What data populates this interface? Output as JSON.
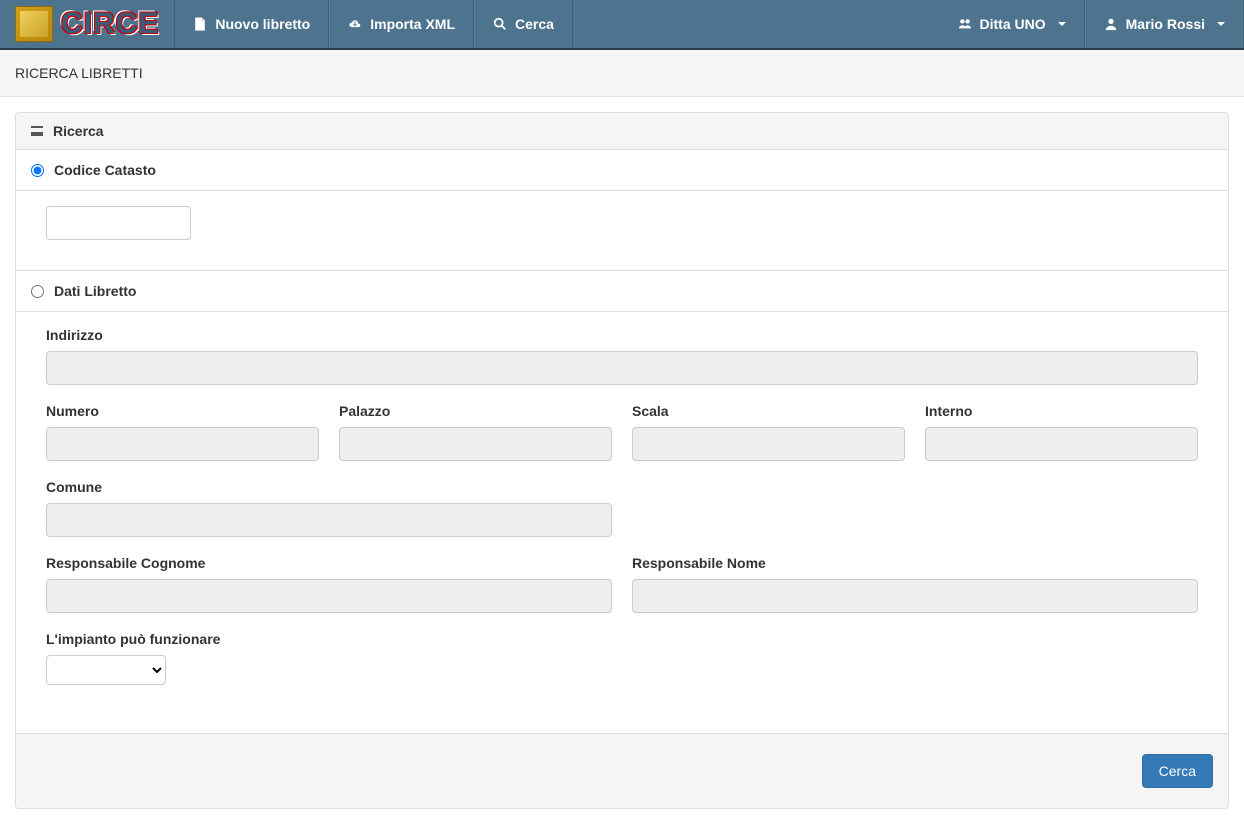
{
  "navbar": {
    "brand": "CIRCE",
    "nuovo_libretto": "Nuovo libretto",
    "importa_xml": "Importa XML",
    "cerca": "Cerca",
    "ditta": "Ditta UNO",
    "user": "Mario Rossi"
  },
  "page_title": "RICERCA LIBRETTI",
  "panel_title": "Ricerca",
  "sections": {
    "codice_catasto": {
      "label": "Codice Catasto"
    },
    "dati_libretto": {
      "label": "Dati Libretto"
    }
  },
  "fields": {
    "indirizzo": "Indirizzo",
    "numero": "Numero",
    "palazzo": "Palazzo",
    "scala": "Scala",
    "interno": "Interno",
    "comune": "Comune",
    "resp_cognome": "Responsabile Cognome",
    "resp_nome": "Responsabile Nome",
    "impianto_funz": "L'impianto può funzionare"
  },
  "values": {
    "codice_catasto": "",
    "indirizzo": "",
    "numero": "",
    "palazzo": "",
    "scala": "",
    "interno": "",
    "comune": "",
    "resp_cognome": "",
    "resp_nome": "",
    "impianto_funz": ""
  },
  "footer": {
    "cerca_btn": "Cerca"
  }
}
